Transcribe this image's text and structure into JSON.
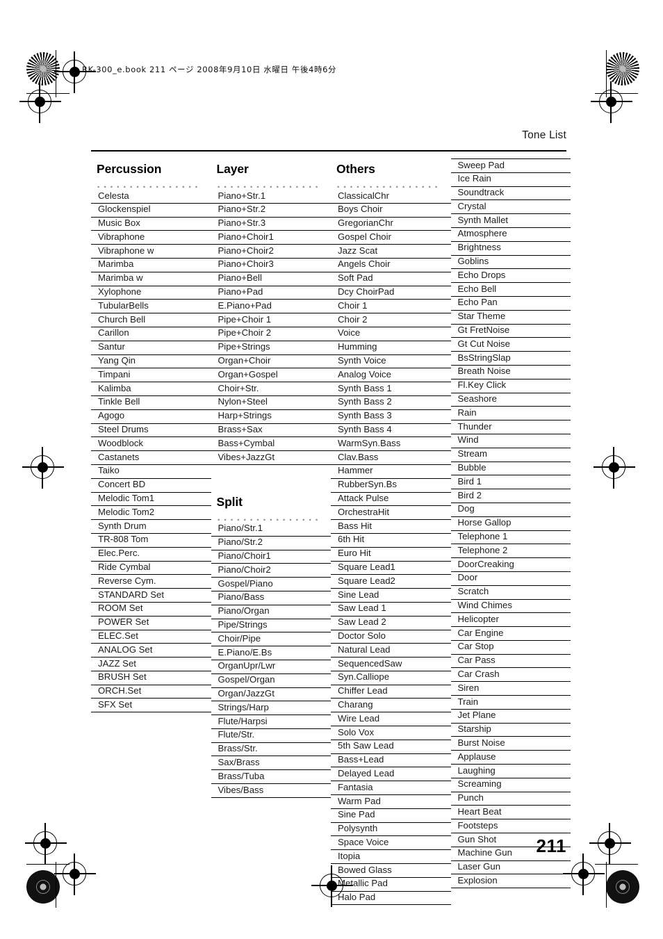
{
  "document": {
    "file_info": "RK-300_e.book 211 ページ 2008年9月10日 水曜日 午後4時6分",
    "running_head": "Tone List",
    "page_number": "211"
  },
  "columns": [
    {
      "heading": "Percussion",
      "items": [
        "Celesta",
        "Glockenspiel",
        "Music Box",
        "Vibraphone",
        "Vibraphone w",
        "Marimba",
        "Marimba w",
        "Xylophone",
        "TubularBells",
        "Church Bell",
        "Carillon",
        "Santur",
        "Yang Qin",
        "Timpani",
        "Kalimba",
        "Tinkle Bell",
        "Agogo",
        "Steel Drums",
        "Woodblock",
        "Castanets",
        "Taiko",
        "Concert BD",
        "Melodic Tom1",
        "Melodic Tom2",
        "Synth Drum",
        "TR-808 Tom",
        "Elec.Perc.",
        "Ride Cymbal",
        "Reverse Cym.",
        "STANDARD Set",
        "ROOM Set",
        "POWER Set",
        "ELEC.Set",
        "ANALOG Set",
        "JAZZ Set",
        "BRUSH Set",
        "ORCH.Set",
        "SFX Set"
      ]
    },
    {
      "heading": "Layer",
      "items": [
        "Piano+Str.1",
        "Piano+Str.2",
        "Piano+Str.3",
        "Piano+Choir1",
        "Piano+Choir2",
        "Piano+Choir3",
        "Piano+Bell",
        "Piano+Pad",
        "E.Piano+Pad",
        "Pipe+Choir 1",
        "Pipe+Choir 2",
        "Pipe+Strings",
        "Organ+Choir",
        "Organ+Gospel",
        "Choir+Str.",
        "Nylon+Steel",
        "Harp+Strings",
        "Brass+Sax",
        "Bass+Cymbal",
        "Vibes+JazzGt"
      ]
    },
    {
      "heading": "Split",
      "items": [
        "Piano/Str.1",
        "Piano/Str.2",
        "Piano/Choir1",
        "Piano/Choir2",
        "Gospel/Piano",
        "Piano/Bass",
        "Piano/Organ",
        "Pipe/Strings",
        "Choir/Pipe",
        "E.Piano/E.Bs",
        "OrganUpr/Lwr",
        "Gospel/Organ",
        "Organ/JazzGt",
        "Strings/Harp",
        "Flute/Harpsi",
        "Flute/Str.",
        "Brass/Str.",
        "Sax/Brass",
        "Brass/Tuba",
        "Vibes/Bass"
      ]
    },
    {
      "heading": "Others",
      "items": [
        "ClassicalChr",
        "Boys Choir",
        "GregorianChr",
        "Gospel Choir",
        "Jazz Scat",
        "Angels Choir",
        "Soft Pad",
        "Dcy ChoirPad",
        "Choir 1",
        "Choir 2",
        "Voice",
        "Humming",
        "Synth Voice",
        "Analog Voice",
        "Synth Bass 1",
        "Synth Bass 2",
        "Synth Bass 3",
        "Synth Bass 4",
        "WarmSyn.Bass",
        "Clav.Bass",
        "Hammer",
        "RubberSyn.Bs",
        "Attack Pulse",
        "OrchestraHit",
        "Bass Hit",
        "6th Hit",
        "Euro Hit",
        "Square Lead1",
        "Square Lead2",
        "Sine Lead",
        "Saw Lead 1",
        "Saw Lead 2",
        "Doctor Solo",
        "Natural Lead",
        "SequencedSaw",
        "Syn.Calliope",
        "Chiffer Lead",
        "Charang",
        "Wire Lead",
        "Solo Vox",
        "5th Saw Lead",
        "Bass+Lead",
        "Delayed Lead",
        "Fantasia",
        "Warm Pad",
        "Sine Pad",
        "Polysynth",
        "Space Voice",
        "Itopia",
        "Bowed Glass",
        "Metallic Pad",
        "Halo Pad"
      ]
    },
    {
      "heading": "",
      "items": [
        "Sweep Pad",
        "Ice Rain",
        "Soundtrack",
        "Crystal",
        "Synth Mallet",
        "Atmosphere",
        "Brightness",
        "Goblins",
        "Echo Drops",
        "Echo Bell",
        "Echo Pan",
        "Star Theme",
        "Gt FretNoise",
        "Gt Cut Noise",
        "BsStringSlap",
        "Breath Noise",
        "Fl.Key Click",
        "Seashore",
        "Rain",
        "Thunder",
        "Wind",
        "Stream",
        "Bubble",
        "Bird 1",
        "Bird 2",
        "Dog",
        "Horse Gallop",
        "Telephone 1",
        "Telephone 2",
        "DoorCreaking",
        "Door",
        "Scratch",
        "Wind Chimes",
        "Helicopter",
        "Car Engine",
        "Car Stop",
        "Car Pass",
        "Car Crash",
        "Siren",
        "Train",
        "Jet Plane",
        "Starship",
        "Burst Noise",
        "Applause",
        "Laughing",
        "Screaming",
        "Punch",
        "Heart Beat",
        "Footsteps",
        "Gun Shot",
        "Machine Gun",
        "Laser Gun",
        "Explosion"
      ]
    }
  ]
}
